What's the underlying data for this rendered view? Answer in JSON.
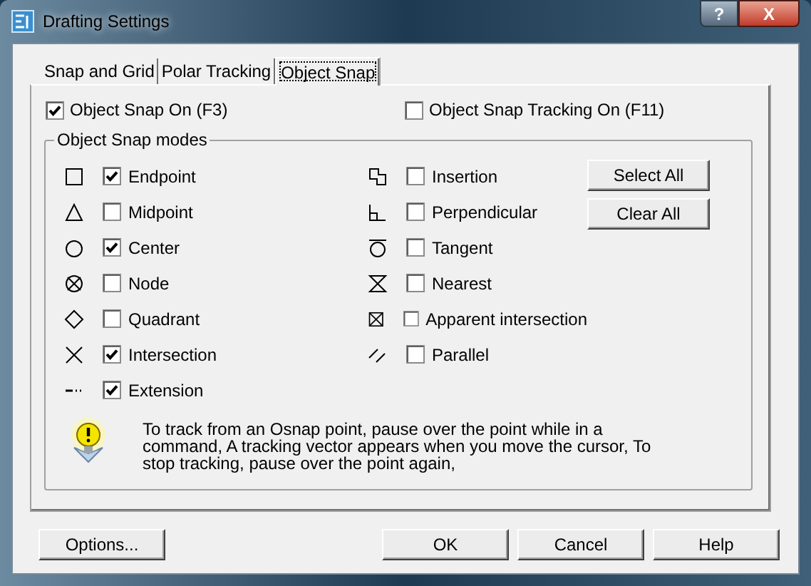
{
  "window": {
    "title": "Drafting Settings",
    "title_buttons": [
      "?",
      "X"
    ]
  },
  "tabs": [
    {
      "label": "Snap and Grid",
      "selected": false
    },
    {
      "label": "Polar Tracking",
      "selected": false
    },
    {
      "label": "Object Snap",
      "selected": true
    }
  ],
  "object_snap_on": {
    "label": "Object Snap On (F3)",
    "checked": true
  },
  "object_snap_tracking_on": {
    "label": "Object Snap Tracking On (F11)",
    "checked": false
  },
  "modes_group": {
    "title": "Object Snap modes",
    "left_modes": [
      {
        "kind": "endpoint",
        "label": "Endpoint",
        "checked": true
      },
      {
        "kind": "midpoint",
        "label": "Midpoint",
        "checked": false
      },
      {
        "kind": "center",
        "label": "Center",
        "checked": true
      },
      {
        "kind": "node",
        "label": "Node",
        "checked": false
      },
      {
        "kind": "quadrant",
        "label": "Quadrant",
        "checked": false
      },
      {
        "kind": "intersection",
        "label": "Intersection",
        "checked": true
      },
      {
        "kind": "extension",
        "label": "Extension",
        "checked": true
      }
    ],
    "right_modes": [
      {
        "kind": "insertion",
        "label": "Insertion",
        "checked": false
      },
      {
        "kind": "perpendicular",
        "label": "Perpendicular",
        "checked": false
      },
      {
        "kind": "tangent",
        "label": "Tangent",
        "checked": false
      },
      {
        "kind": "nearest",
        "label": "Nearest",
        "checked": false
      },
      {
        "kind": "apparent",
        "label": "Apparent intersection",
        "checked": false
      },
      {
        "kind": "parallel",
        "label": "Parallel",
        "checked": false
      }
    ],
    "buttons": [
      "Select All",
      "Clear All"
    ],
    "hint": "To track from an Osnap point, pause over the point while in a command,  A tracking vector appears when you move the cursor, To stop tracking, pause over the point again,"
  },
  "footer_buttons": [
    "Options...",
    "OK",
    "Cancel",
    "Help"
  ]
}
